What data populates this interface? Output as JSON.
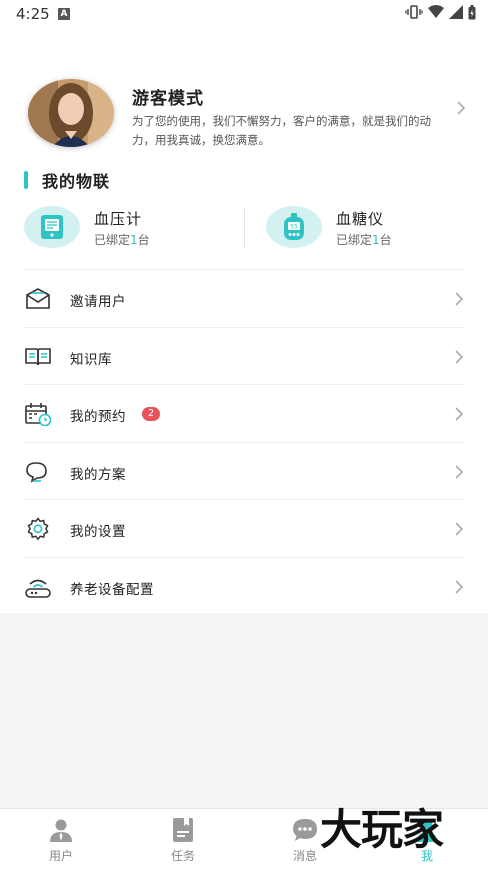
{
  "status_bar": {
    "time": "4:25",
    "notification_icon": "A"
  },
  "profile": {
    "name": "游客模式",
    "description": "为了您的使用，我们不懈努力，客户的满意，就是我们的动力，用我真诚，换您满意。"
  },
  "section": {
    "title": "我的物联"
  },
  "devices": [
    {
      "name": "血压计",
      "status_prefix": "已绑定",
      "count": "1",
      "unit": "台",
      "icon": "blood-pressure-monitor-icon"
    },
    {
      "name": "血糖仪",
      "status_prefix": "已绑定",
      "count": "1",
      "unit": "台",
      "icon": "glucose-meter-icon"
    }
  ],
  "menu": [
    {
      "label": "邀请用户",
      "icon": "envelope-icon"
    },
    {
      "label": "知识库",
      "icon": "book-icon"
    },
    {
      "label": "我的预约",
      "icon": "calendar-clock-icon",
      "badge": "2"
    },
    {
      "label": "我的方案",
      "icon": "speech-bubble-icon"
    },
    {
      "label": "我的设置",
      "icon": "gear-icon"
    },
    {
      "label": "养老设备配置",
      "icon": "router-icon"
    }
  ],
  "tabbar": [
    {
      "label": "用户",
      "icon": "user-icon",
      "active": false
    },
    {
      "label": "任务",
      "icon": "task-icon",
      "active": false
    },
    {
      "label": "消息",
      "icon": "message-icon",
      "active": false
    },
    {
      "label": "我",
      "icon": "me-icon",
      "active": true
    }
  ],
  "colors": {
    "accent": "#2ec4c4",
    "badge": "#e8545a",
    "device_circle": "#d4f1f2"
  },
  "watermark": "大玩家"
}
